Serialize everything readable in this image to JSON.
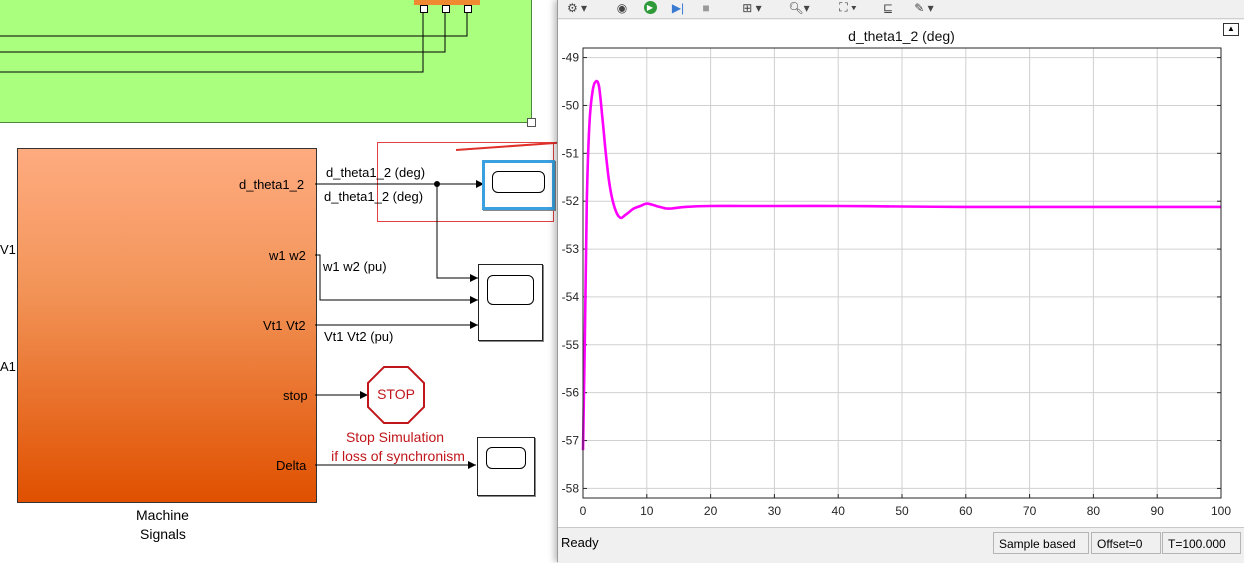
{
  "diagram": {
    "colors": {
      "subsystem_top": "#ffab80",
      "subsystem_bottom": "#e05000",
      "green_area": "#aaff7f",
      "signal_red": "#c0161b"
    },
    "machine_block": {
      "name_line1": "Machine",
      "name_line2": "Signals",
      "ports": [
        "d_theta1_2",
        "w1 w2",
        "Vt1 Vt2",
        "stop",
        "Delta"
      ]
    },
    "left_edge_labels": [
      "V1",
      "A1"
    ],
    "signals": {
      "d_theta_top": "d_theta1_2 (deg)",
      "d_theta_bottom": "d_theta1_2 (deg)",
      "w": "w1 w2 (pu)",
      "vt": "Vt1 Vt2 (pu)"
    },
    "stop_block": {
      "label": "STOP"
    },
    "stop_annotation": {
      "line1": "Stop Simulation",
      "line2": "if loss of synchronism"
    }
  },
  "scope": {
    "toolbar_icons": [
      "settings-icon",
      "step-back-icon",
      "run-icon",
      "step-forward-icon",
      "stop-icon",
      "signal-select-icon",
      "zoom-icon",
      "autoscale-icon",
      "cursor-measure-icon",
      "highlight-icon"
    ],
    "plot": {
      "title": "d_theta1_2 (deg)",
      "line_color": "#ff00ff"
    },
    "status": {
      "ready": "Ready",
      "sample": "Sample based",
      "offset": "Offset=0",
      "time": "T=100.000"
    }
  },
  "chart_data": {
    "type": "line",
    "title": "d_theta1_2 (deg)",
    "xlabel": "",
    "ylabel": "",
    "xlim": [
      0,
      100
    ],
    "ylim": [
      -58.2,
      -48.8
    ],
    "x_ticks": [
      0,
      10,
      20,
      30,
      40,
      50,
      60,
      70,
      80,
      90,
      100
    ],
    "y_ticks": [
      -49,
      -50,
      -51,
      -52,
      -53,
      -54,
      -55,
      -56,
      -57,
      -58
    ],
    "grid": true,
    "series": [
      {
        "color": "#ff00ff",
        "x": [
          0,
          0.3,
          0.6,
          1.0,
          1.5,
          2.0,
          2.5,
          3.0,
          3.5,
          4.0,
          4.5,
          5.0,
          5.5,
          6.0,
          6.5,
          7.0,
          8.0,
          9.0,
          10.0,
          11.0,
          12.0,
          13.0,
          14.0,
          16.0,
          20.0,
          25.0,
          30.0,
          40.0,
          50.0,
          60.0,
          70.0,
          80.0,
          90.0,
          100.0
        ],
        "values": [
          -57.2,
          -54.8,
          -52.0,
          -50.4,
          -49.7,
          -49.5,
          -49.6,
          -50.2,
          -50.9,
          -51.5,
          -51.9,
          -52.15,
          -52.3,
          -52.35,
          -52.3,
          -52.25,
          -52.15,
          -52.1,
          -52.05,
          -52.08,
          -52.12,
          -52.15,
          -52.15,
          -52.12,
          -52.1,
          -52.1,
          -52.1,
          -52.1,
          -52.11,
          -52.12,
          -52.12,
          -52.12,
          -52.12,
          -52.12
        ]
      }
    ]
  }
}
